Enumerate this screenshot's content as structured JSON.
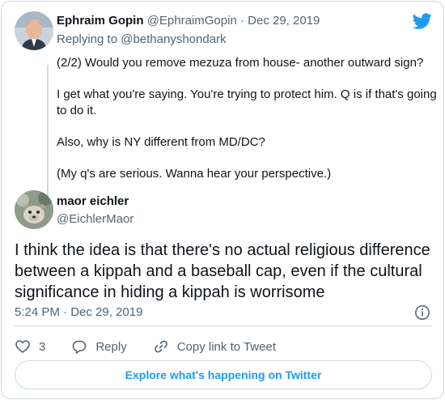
{
  "parent_tweet": {
    "author_name": "Ephraim Gopin",
    "handle": "@EphraimGopin",
    "separator": "·",
    "date": "Dec 29, 2019",
    "replying_prefix": "Replying to",
    "replying_to": "@bethanyshondark",
    "paragraphs": [
      "(2/2) Would you remove mezuza from house- another outward sign?",
      "I get what you're saying. You're trying to protect him. Q is if that's going to do it.",
      "Also, why is NY different from MD/DC?",
      "(My q's are serious. Wanna hear your perspective.)"
    ]
  },
  "main_tweet": {
    "author_name": "maor eichler",
    "handle": "@EichlerMaor",
    "text": "I think the idea is that there's no actual religious difference between a kippah and a baseball cap, even if the cultural significance in hiding a kippah is worrisome",
    "timestamp": "5:24 PM · Dec 29, 2019"
  },
  "actions": {
    "like_count": "3",
    "reply_label": "Reply",
    "copy_link_label": "Copy link to Tweet"
  },
  "explore_label": "Explore what's happening on Twitter",
  "colors": {
    "brand_blue": "#1d9bf0",
    "text_primary": "#0f1419",
    "text_secondary": "#536471",
    "border": "#cfd9de"
  },
  "icons": [
    "twitter-bird-icon",
    "info-icon",
    "heart-icon",
    "reply-icon",
    "link-icon"
  ]
}
